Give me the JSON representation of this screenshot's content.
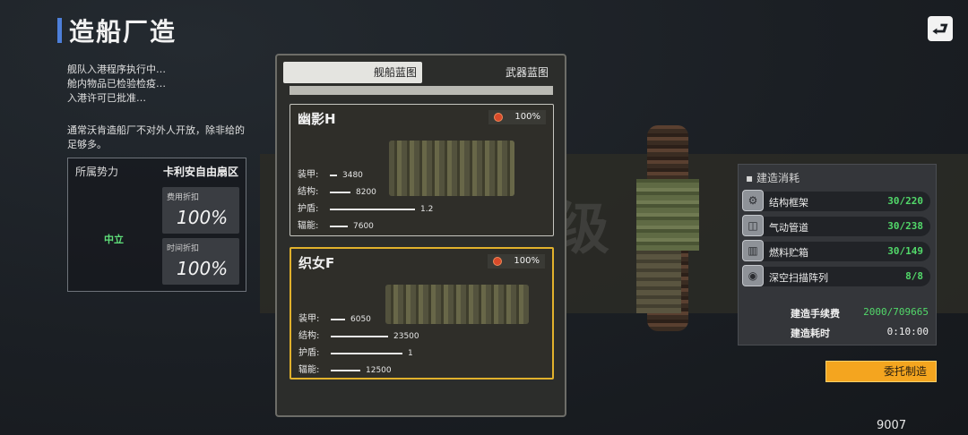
{
  "header": {
    "title": "造船厂造",
    "back_icon": "back-arrow-icon"
  },
  "status_lines": [
    "舰队入港程序执行中…",
    "舱内物品已检验检疫…",
    "入港许可已批准…"
  ],
  "notice": "通常沃肯造船厂不对外人开放，除非给的足够多。",
  "faction": {
    "label": "所属势力",
    "name": "卡利安自由扇区",
    "status": "中立",
    "fee_discount_label": "费用折扣",
    "fee_discount_value": "100%",
    "time_discount_label": "时间折扣",
    "time_discount_value": "100%"
  },
  "tabs": {
    "ship": "舰船蓝图",
    "weapon": "武器蓝图"
  },
  "ships": [
    {
      "name": "幽影H",
      "percent": "100%",
      "stats": [
        {
          "label": "装甲:",
          "value": "3480",
          "level": 0.05
        },
        {
          "label": "结构:",
          "value": "8200",
          "level": 0.23
        },
        {
          "label": "护盾:",
          "value": "1.2",
          "level": 0.95
        },
        {
          "label": "辐能:",
          "value": "7600",
          "level": 0.2
        }
      ]
    },
    {
      "name": "织女F",
      "percent": "100%",
      "stats": [
        {
          "label": "装甲:",
          "value": "6050",
          "level": 0.16
        },
        {
          "label": "结构:",
          "value": "23500",
          "level": 0.64
        },
        {
          "label": "护盾:",
          "value": "1",
          "level": 0.8
        },
        {
          "label": "辐能:",
          "value": "12500",
          "level": 0.33
        }
      ]
    }
  ],
  "watermark": "钉枪级",
  "cost": {
    "title": "建造消耗",
    "items": [
      {
        "name": "结构框架",
        "value": "30/220",
        "icon": "frame-icon"
      },
      {
        "name": "气动管道",
        "value": "30/238",
        "icon": "pipe-icon"
      },
      {
        "name": "燃料贮箱",
        "value": "30/149",
        "icon": "fuel-tank-icon"
      },
      {
        "name": "深空扫描阵列",
        "value": "8/8",
        "icon": "scanner-icon"
      }
    ],
    "fee_label": "建造手续费",
    "fee_value": "2000/709665",
    "time_label": "建造耗时",
    "time_value": "0:10:00"
  },
  "commission_button": "委托制造",
  "footer_number": "9007",
  "colors": {
    "accent_green": "#52d96a",
    "accent_orange": "#f4a51f",
    "selected_border": "#e1b12c",
    "title_bar": "#4d7fd9"
  }
}
